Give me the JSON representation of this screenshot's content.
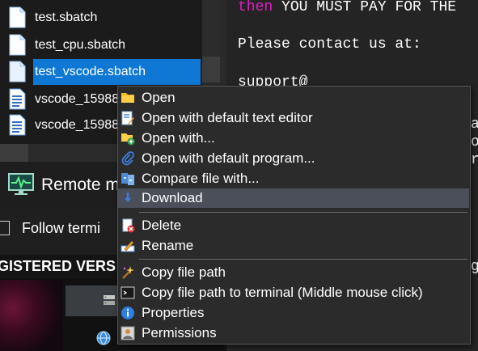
{
  "file_list": {
    "items": [
      {
        "name": "test.sbatch",
        "selected": false
      },
      {
        "name": "test_cpu.sbatch",
        "selected": false
      },
      {
        "name": "test_vscode.sbatch",
        "selected": true
      },
      {
        "name": "vscode_15988",
        "selected": false
      },
      {
        "name": "vscode_15988",
        "selected": false
      }
    ]
  },
  "remote": {
    "label": "Remote m"
  },
  "follow": {
    "label": "Follow termi"
  },
  "registered": {
    "title": "GISTERED VERS"
  },
  "terminal": {
    "line1_kw": "then",
    "line1_rest": " YOU MUST PAY FOR THE",
    "line2": "Please contact us at:",
    "line3": "support@",
    "right_fragments": [
      "a",
      "o",
      "r",
      "g"
    ]
  },
  "context_menu": {
    "items": [
      {
        "label": "Open",
        "icon": "folder-icon"
      },
      {
        "label": "Open with default text editor",
        "icon": "text-editor-icon"
      },
      {
        "label": "Open with...",
        "icon": "open-with-icon"
      },
      {
        "label": "Open with default program...",
        "icon": "paperclip-icon"
      },
      {
        "label": "Compare file with...",
        "icon": "compare-icon"
      },
      {
        "label": "Download",
        "icon": "download-icon",
        "hovered": true
      },
      {
        "label": "Delete",
        "icon": "delete-icon"
      },
      {
        "label": "Rename",
        "icon": "rename-icon"
      },
      {
        "label": "Copy file path",
        "icon": "magic-wand-icon"
      },
      {
        "label": "Copy file path to terminal (Middle mouse click)",
        "icon": "terminal-icon"
      },
      {
        "label": "Properties",
        "icon": "info-icon"
      },
      {
        "label": "Permissions",
        "icon": "permissions-icon"
      }
    ]
  },
  "colors": {
    "selection": "#0f78d4",
    "keyword": "#e21cc7",
    "menu_bg": "#2b2b2b",
    "menu_hover": "#4a4f5a"
  }
}
